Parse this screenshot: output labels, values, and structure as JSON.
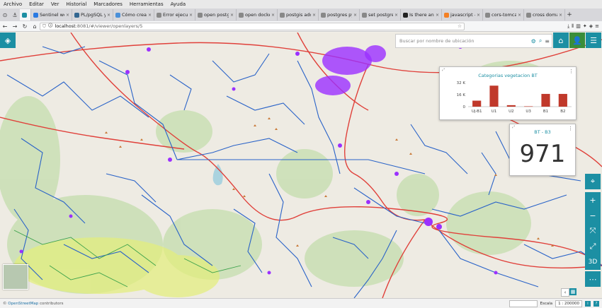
{
  "menu": [
    "Archivo",
    "Editar",
    "Ver",
    "Historial",
    "Marcadores",
    "Herramientas",
    "Ayuda"
  ],
  "tabs": [
    {
      "label": "Sentinel weat",
      "color": "#2a7ae2",
      "active": false
    },
    {
      "label": "PL/pgSQL y c",
      "color": "#336791",
      "active": false
    },
    {
      "label": "Cómo crear y",
      "color": "#4a90d9",
      "active": false
    },
    {
      "label": "Error ejecuti",
      "color": "#888888",
      "active": false
    },
    {
      "label": "open postgres",
      "color": "#888888",
      "active": false
    },
    {
      "label": "open docker p",
      "color": "#888888",
      "active": false
    },
    {
      "label": "postgis add fi",
      "color": "#888888",
      "active": false
    },
    {
      "label": "postgres pyth",
      "color": "#888888",
      "active": false
    },
    {
      "label": "set postgres",
      "color": "#888888",
      "active": false
    },
    {
      "label": "Is there any w",
      "color": "#222222",
      "active": false
    },
    {
      "label": "javascript - \"I",
      "color": "#f48024",
      "active": false
    },
    {
      "label": "cors-tomcat-",
      "color": "#888888",
      "active": false
    },
    {
      "label": "cross doma",
      "color": "#888888",
      "active": false
    }
  ],
  "nav": {
    "url_host": "localhost",
    "url_path": ":8081/#/viewer/openlayers/5"
  },
  "search": {
    "placeholder": "Buscar por nombre de ubicación"
  },
  "chart_widget": {
    "title": "Categorias vegetacion BT"
  },
  "chart_data": {
    "type": "bar",
    "title": "Categorias vegetacion BT",
    "categories": [
      "Uj-B1",
      "U1",
      "U2",
      "U3",
      "B1",
      "B2"
    ],
    "tick_labels": [
      "Uj-B1",
      "U1",
      "U2",
      "U3",
      "B1",
      "B2"
    ],
    "values": [
      8000,
      28000,
      2000,
      500,
      17000,
      17000
    ],
    "yticks": [
      "32 K",
      "16 K",
      "0"
    ],
    "ylim": [
      0,
      32000
    ],
    "xlabel": "",
    "ylabel": "",
    "bar_color": "#c0392b"
  },
  "counter_widget": {
    "title": "BT - B3",
    "value": "971"
  },
  "right_toolbar": [
    "locate-icon",
    "zoom-in",
    "zoom-out",
    "select",
    "fullscreen",
    "3D",
    "more"
  ],
  "toolbar_3d_label": "3D",
  "status": {
    "attribution_prefix": "© ",
    "attribution_link": "OpenStreetMap",
    "attribution_suffix": " contributors",
    "coords": "",
    "scale_label": "Escala",
    "scale_value": "1 : 200000"
  },
  "colors": {
    "accent": "#1c8fa3",
    "home": "#1c8fa3",
    "user": "#3a8d3a",
    "network_blue": "#2a63c8",
    "network_purple": "#9b30ff",
    "roads_red": "#e0403a"
  }
}
